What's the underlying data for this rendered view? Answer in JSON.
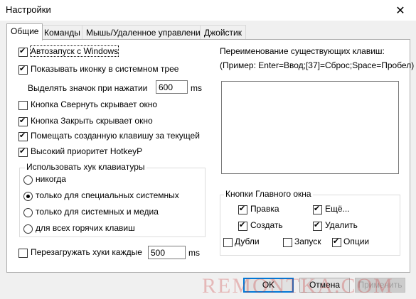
{
  "window": {
    "title": "Настройки"
  },
  "tabs": [
    {
      "label": "Общие",
      "active": true
    },
    {
      "label": "Команды"
    },
    {
      "label": "Мышь/Удаленное управление"
    },
    {
      "label": "Джойстик"
    }
  ],
  "general": {
    "autostart": "Автозапуск с Windows",
    "tray_icon": "Показывать иконку в системном трее",
    "highlight_label": "Выделять значок при нажатии",
    "highlight_value": "600",
    "highlight_unit": "ms",
    "minimize_hides": "Кнопка Свернуть скрывает окно",
    "close_hides": "Кнопка Закрыть скрывает окно",
    "place_after": "Помещать созданную клавишу за текущей",
    "high_priority": "Высокий приоритет HotkeyP"
  },
  "hook_group": {
    "legend": "Использовать хук клавиатуры",
    "options": [
      "никогда",
      "только для специальных системных",
      "только для системных и медиа",
      "для всех горячих клавиш"
    ],
    "selected": 1
  },
  "reload": {
    "label": "Перезагружать хуки каждые",
    "value": "500",
    "unit": "ms"
  },
  "rename": {
    "title": "Переименование существующих клавиш:",
    "example": "(Пример: Enter=Ввод;[37]=Сброс;Space=Пробел)",
    "value": ""
  },
  "main_buttons": {
    "legend": "Кнопки Главного окна",
    "edit": "Правка",
    "more": "Ещё...",
    "create": "Создать",
    "delete": "Удалить",
    "duplicates": "Дубли",
    "launch": "Запуск",
    "options": "Опции"
  },
  "footer": {
    "ok": "OK",
    "cancel": "Отмена",
    "apply": "Применить"
  },
  "watermark": "REMONTKA.COM",
  "colors": {
    "accent": "#0078d7",
    "panel_border": "#adadad",
    "watermark": "#c82828"
  }
}
